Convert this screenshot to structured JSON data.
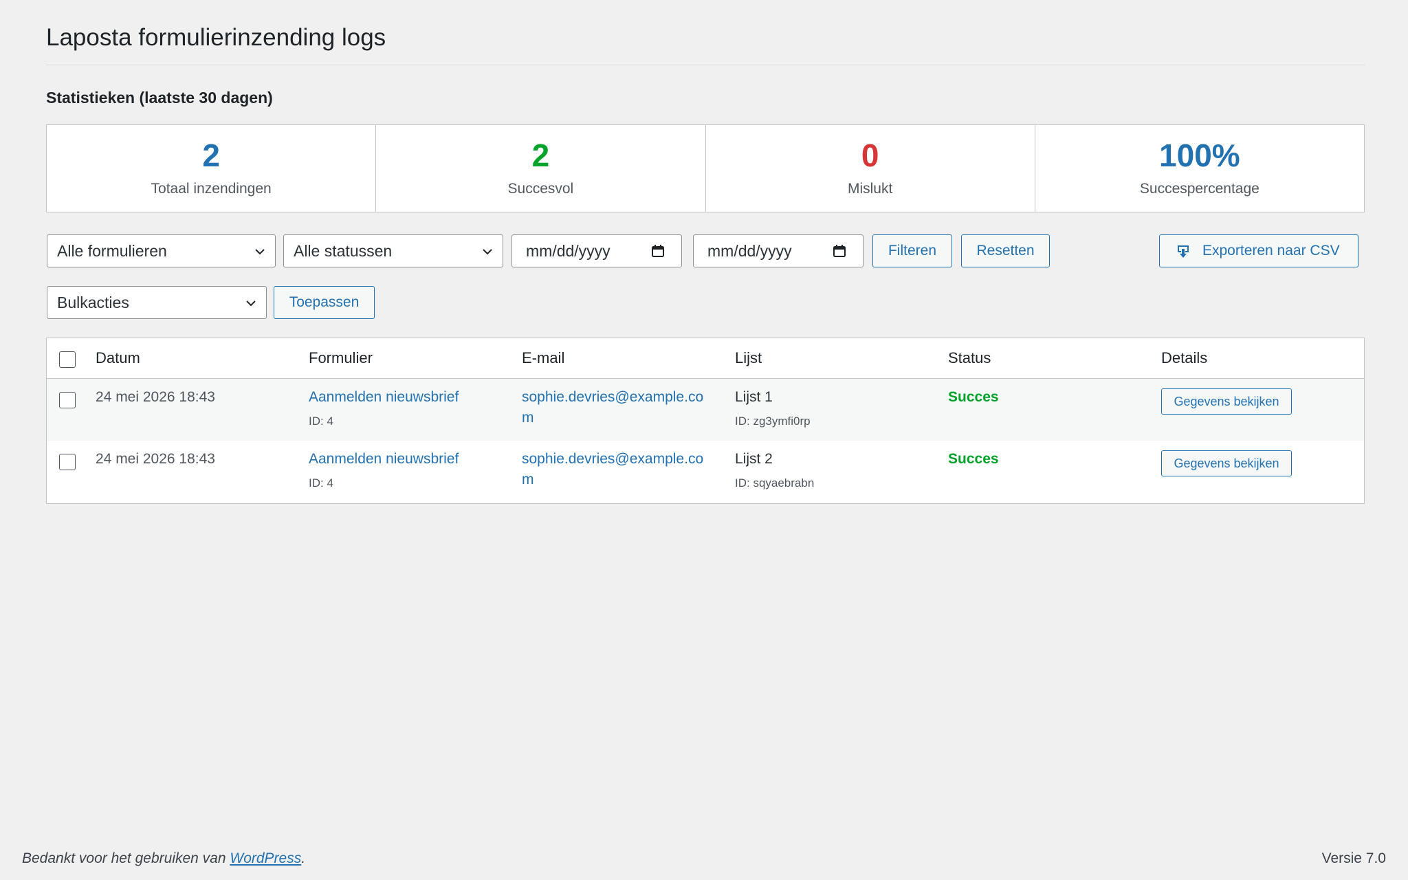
{
  "page": {
    "title": "Laposta formulierinzending logs"
  },
  "stats": {
    "heading": "Statistieken (laatste 30 dagen)",
    "items": [
      {
        "value": "2",
        "label": "Totaal inzendingen",
        "color": "#2271b1"
      },
      {
        "value": "2",
        "label": "Succesvol",
        "color": "#00a32a"
      },
      {
        "value": "0",
        "label": "Mislukt",
        "color": "#d63638"
      },
      {
        "value": "100%",
        "label": "Succespercentage",
        "color": "#2271b1"
      }
    ]
  },
  "filters": {
    "form_select": "Alle formulieren",
    "status_select": "Alle statussen",
    "date_from": "mm/dd/yyyy",
    "date_to": "mm/dd/yyyy",
    "filter_button": "Filteren",
    "reset_button": "Resetten",
    "export_button": "Exporteren naar CSV"
  },
  "bulk": {
    "select": "Bulkacties",
    "apply_button": "Toepassen"
  },
  "table": {
    "columns": [
      "Datum",
      "Formulier",
      "E-mail",
      "Lijst",
      "Status",
      "Details"
    ],
    "rows": [
      {
        "date": "24 mei 2026 18:43",
        "form": "Aanmelden nieuwsbrief",
        "form_id": "ID: 4",
        "email": "sophie.devries@example.com",
        "list": "Lijst 1",
        "list_id": "ID: zg3ymfi0rp",
        "status": "Succes",
        "details_button": "Gegevens bekijken"
      },
      {
        "date": "24 mei 2026 18:43",
        "form": "Aanmelden nieuwsbrief",
        "form_id": "ID: 4",
        "email": "sophie.devries@example.com",
        "list": "Lijst 2",
        "list_id": "ID: sqyaebrabn",
        "status": "Succes",
        "details_button": "Gegevens bekijken"
      }
    ]
  },
  "footer": {
    "thanks_prefix": "Bedankt voor het gebruiken van ",
    "thanks_link": "WordPress",
    "thanks_suffix": ".",
    "version": "Versie 7.0"
  },
  "icons": {
    "chevron": "chevron-down-icon",
    "calendar": "calendar-icon",
    "export": "download-icon"
  },
  "colors": {
    "accent": "#2271b1",
    "success": "#00a32a",
    "error": "#d63638",
    "background": "#f0f0f1"
  }
}
